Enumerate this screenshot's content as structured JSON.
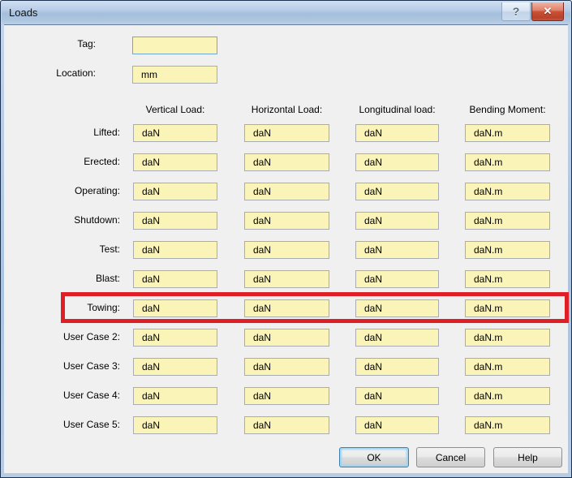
{
  "window": {
    "title": "Loads",
    "help_glyph": "?",
    "close_glyph": "✕"
  },
  "fields": {
    "tag": {
      "label": "Tag:",
      "value": ""
    },
    "location": {
      "label": "Location:",
      "value": "mm"
    }
  },
  "grid": {
    "column_headers": [
      "Vertical Load:",
      "Horizontal Load:",
      "Longitudinal load:",
      "Bending Moment:"
    ],
    "rows": [
      {
        "label": "Lifted:",
        "values": [
          "daN",
          "daN",
          "daN",
          "daN.m"
        ],
        "highlighted": false
      },
      {
        "label": "Erected:",
        "values": [
          "daN",
          "daN",
          "daN",
          "daN.m"
        ],
        "highlighted": false
      },
      {
        "label": "Operating:",
        "values": [
          "daN",
          "daN",
          "daN",
          "daN.m"
        ],
        "highlighted": false
      },
      {
        "label": "Shutdown:",
        "values": [
          "daN",
          "daN",
          "daN",
          "daN.m"
        ],
        "highlighted": false
      },
      {
        "label": "Test:",
        "values": [
          "daN",
          "daN",
          "daN",
          "daN.m"
        ],
        "highlighted": false
      },
      {
        "label": "Blast:",
        "values": [
          "daN",
          "daN",
          "daN",
          "daN.m"
        ],
        "highlighted": false
      },
      {
        "label": "Towing:",
        "values": [
          "daN",
          "daN",
          "daN",
          "daN.m"
        ],
        "highlighted": true
      },
      {
        "label": "User Case 2:",
        "values": [
          "daN",
          "daN",
          "daN",
          "daN.m"
        ],
        "highlighted": false
      },
      {
        "label": "User Case 3:",
        "values": [
          "daN",
          "daN",
          "daN",
          "daN.m"
        ],
        "highlighted": false
      },
      {
        "label": "User Case 4:",
        "values": [
          "daN",
          "daN",
          "daN",
          "daN.m"
        ],
        "highlighted": false
      },
      {
        "label": "User Case 5:",
        "values": [
          "daN",
          "daN",
          "daN",
          "daN.m"
        ],
        "highlighted": false
      }
    ]
  },
  "buttons": {
    "ok": "OK",
    "cancel": "Cancel",
    "help": "Help"
  },
  "colors": {
    "input_bg": "#fbf4b8",
    "highlight_red": "#df1f26",
    "focus_border": "#6ea7dc",
    "client_bg": "#f0f0f0"
  }
}
